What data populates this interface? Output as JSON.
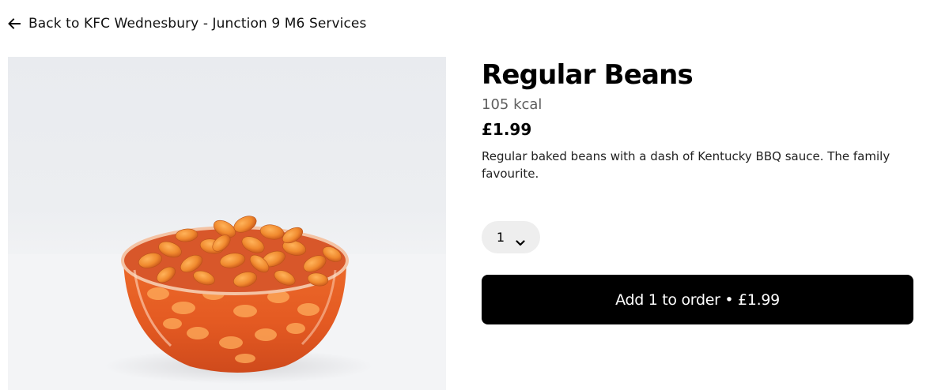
{
  "navigation": {
    "back_label": "Back to KFC Wednesbury - Junction 9 M6 Services",
    "back_icon": "arrow-left-icon"
  },
  "item": {
    "image_alt": "Regular Beans",
    "name": "Regular Beans",
    "calories": "105 kcal",
    "price": "£1.99",
    "description": "Regular baked beans with a dash of Kentucky BBQ sauce. The family favourite."
  },
  "quantity": {
    "selected": "1",
    "icon": "chevron-down-icon"
  },
  "order_button": {
    "label": "Add 1 to order • £1.99"
  },
  "colors": {
    "button_bg": "#000000",
    "button_text": "#ffffff",
    "quantity_bg": "#eeeeee",
    "kcal_text": "#5e5e5e"
  }
}
